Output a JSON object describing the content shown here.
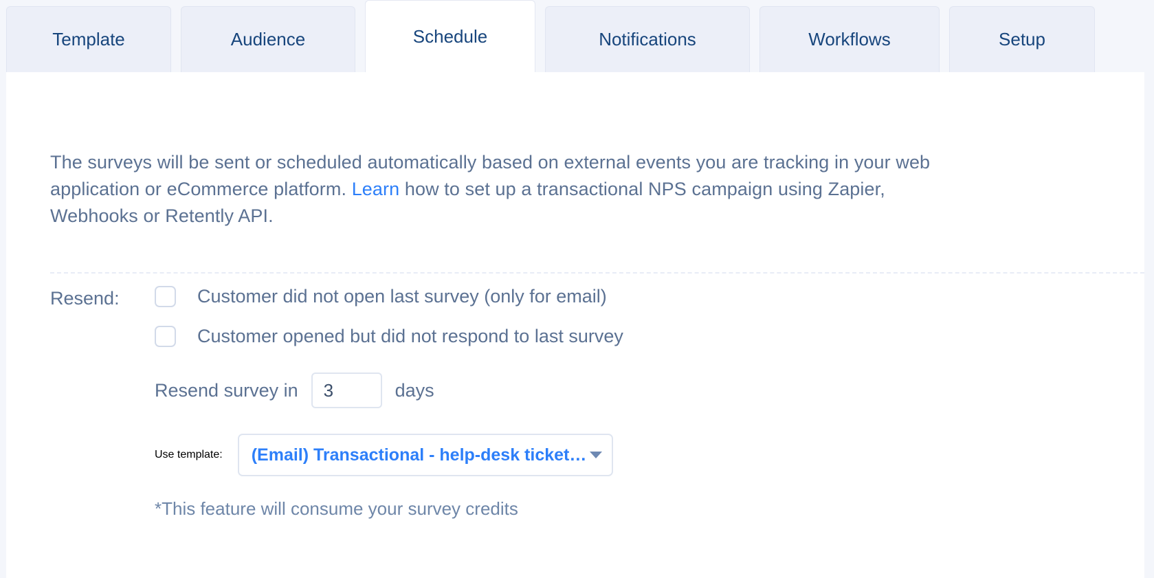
{
  "tabs": [
    {
      "label": "Template",
      "active": false
    },
    {
      "label": "Audience",
      "active": false
    },
    {
      "label": "Schedule",
      "active": true
    },
    {
      "label": "Notifications",
      "active": false
    },
    {
      "label": "Workflows",
      "active": false
    },
    {
      "label": "Setup",
      "active": false
    }
  ],
  "intro": {
    "part1": "The surveys will be sent or scheduled automatically based on external events you are tracking in your web application or eCommerce platform. ",
    "link": "Learn",
    "part2": " how to set up a transactional NPS campaign using Zapier, Webhooks or Retently API."
  },
  "resend": {
    "label": "Resend:",
    "options": [
      {
        "label": "Customer did not open last survey (only for email)",
        "checked": false
      },
      {
        "label": "Customer opened but did not respond to last survey",
        "checked": false
      }
    ],
    "interval": {
      "prefix": "Resend survey in",
      "value": "3",
      "placeholder": "3",
      "suffix": "days"
    },
    "template": {
      "label": "Use template:",
      "selected": "(Email) Transactional - help-desk ticket u...",
      "caret_icon": "chevron-down-icon"
    },
    "footnote": "*This feature will consume your survey credits"
  },
  "colors": {
    "page_background": "#f4f6fb",
    "panel_background": "#ffffff",
    "tab_inactive": "#eceff8",
    "tab_text": "#17457c",
    "body_text": "#5b7192",
    "link": "#2d7ff9",
    "border": "#dfe5f0",
    "footnote_text": "#6e86a8"
  }
}
